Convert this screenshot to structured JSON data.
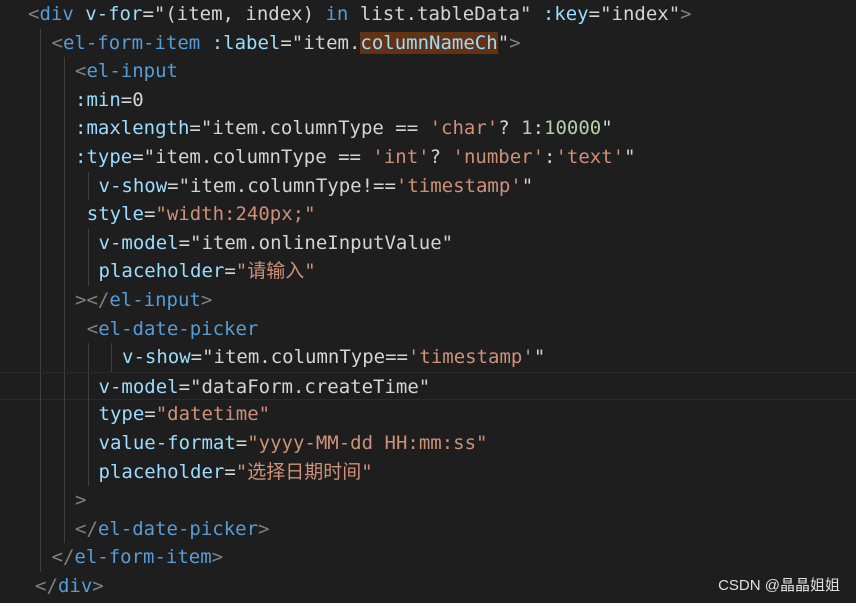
{
  "editor": {
    "lines": [
      {
        "indent": 0,
        "tokens": [
          {
            "t": "<",
            "c": "brk"
          },
          {
            "t": "div",
            "c": "tag"
          },
          {
            "t": " ",
            "c": "txt"
          },
          {
            "t": "v-for",
            "c": "attr"
          },
          {
            "t": "=\"",
            "c": "txt"
          },
          {
            "t": "(item, index) ",
            "c": "txt"
          },
          {
            "t": "in",
            "c": "kw"
          },
          {
            "t": " list.tableData",
            "c": "txt"
          },
          {
            "t": "\" ",
            "c": "txt"
          },
          {
            "t": ":key",
            "c": "attr"
          },
          {
            "t": "=\"index\"",
            "c": "txt"
          },
          {
            "t": ">",
            "c": "brk"
          }
        ]
      },
      {
        "indent": 1,
        "tokens": [
          {
            "t": "<",
            "c": "brk"
          },
          {
            "t": "el-form-item",
            "c": "tag"
          },
          {
            "t": " ",
            "c": "txt"
          },
          {
            "t": ":label",
            "c": "attr"
          },
          {
            "t": "=\"item.",
            "c": "txt"
          },
          {
            "t": "columnNameCh",
            "c": "attr",
            "hl": true
          },
          {
            "t": "\"",
            "c": "txt"
          },
          {
            "t": ">",
            "c": "brk"
          }
        ]
      },
      {
        "indent": 2,
        "tokens": [
          {
            "t": "<",
            "c": "brk"
          },
          {
            "t": "el-input",
            "c": "tag"
          }
        ]
      },
      {
        "indent": 2,
        "tokens": [
          {
            "t": ":min",
            "c": "attr"
          },
          {
            "t": "=0",
            "c": "txt"
          }
        ]
      },
      {
        "indent": 2,
        "tokens": [
          {
            "t": ":maxlength",
            "c": "attr"
          },
          {
            "t": "=\"item.columnType == ",
            "c": "txt"
          },
          {
            "t": "'char'",
            "c": "str"
          },
          {
            "t": "? ",
            "c": "txt"
          },
          {
            "t": "1",
            "c": "num"
          },
          {
            "t": ":",
            "c": "txt"
          },
          {
            "t": "10000",
            "c": "num"
          },
          {
            "t": "\"",
            "c": "txt"
          }
        ]
      },
      {
        "indent": 2,
        "tokens": [
          {
            "t": ":type",
            "c": "attr"
          },
          {
            "t": "=\"item.columnType == ",
            "c": "txt"
          },
          {
            "t": "'int'",
            "c": "str"
          },
          {
            "t": "? ",
            "c": "txt"
          },
          {
            "t": "'number'",
            "c": "str"
          },
          {
            "t": ":",
            "c": "txt"
          },
          {
            "t": "'text'",
            "c": "str"
          },
          {
            "t": "\"",
            "c": "txt"
          }
        ]
      },
      {
        "indent": 3,
        "tokens": [
          {
            "t": "v-show",
            "c": "attr"
          },
          {
            "t": "=\"item.columnType!==",
            "c": "txt"
          },
          {
            "t": "'timestamp'",
            "c": "str"
          },
          {
            "t": "\"",
            "c": "txt"
          }
        ]
      },
      {
        "indent": 2.5,
        "tokens": [
          {
            "t": "style",
            "c": "attr"
          },
          {
            "t": "=",
            "c": "txt"
          },
          {
            "t": "\"width:240px;\"",
            "c": "str"
          }
        ]
      },
      {
        "indent": 3,
        "tokens": [
          {
            "t": "v-model",
            "c": "attr"
          },
          {
            "t": "=\"item.onlineInputValue\"",
            "c": "txt"
          }
        ]
      },
      {
        "indent": 3,
        "tokens": [
          {
            "t": "placeholder",
            "c": "attr"
          },
          {
            "t": "=",
            "c": "txt"
          },
          {
            "t": "\"请输入\"",
            "c": "str"
          }
        ]
      },
      {
        "indent": 2,
        "tokens": [
          {
            "t": "></",
            "c": "brk"
          },
          {
            "t": "el-input",
            "c": "tag"
          },
          {
            "t": ">",
            "c": "brk"
          }
        ]
      },
      {
        "indent": 2.5,
        "tokens": [
          {
            "t": "<",
            "c": "brk"
          },
          {
            "t": "el-date-picker",
            "c": "tag"
          }
        ]
      },
      {
        "indent": 4,
        "tokens": [
          {
            "t": "v-show",
            "c": "attr"
          },
          {
            "t": "=\"item.columnType==",
            "c": "txt"
          },
          {
            "t": "'timestamp'",
            "c": "str"
          },
          {
            "t": "\"",
            "c": "txt"
          }
        ]
      },
      {
        "indent": 3,
        "current": true,
        "tokens": [
          {
            "t": "v-model",
            "c": "attr"
          },
          {
            "t": "=\"dataForm.createTime\"",
            "c": "txt"
          }
        ]
      },
      {
        "indent": 3,
        "tokens": [
          {
            "t": "type",
            "c": "attr"
          },
          {
            "t": "=",
            "c": "txt"
          },
          {
            "t": "\"datetime\"",
            "c": "str"
          }
        ]
      },
      {
        "indent": 3,
        "tokens": [
          {
            "t": "value-format",
            "c": "attr"
          },
          {
            "t": "=",
            "c": "txt"
          },
          {
            "t": "\"yyyy-MM-dd HH:mm:ss\"",
            "c": "str"
          }
        ]
      },
      {
        "indent": 3,
        "tokens": [
          {
            "t": "placeholder",
            "c": "attr"
          },
          {
            "t": "=",
            "c": "txt"
          },
          {
            "t": "\"选择日期时间\"",
            "c": "str"
          }
        ]
      },
      {
        "indent": 2,
        "tokens": [
          {
            "t": ">",
            "c": "brk"
          }
        ]
      },
      {
        "indent": 2,
        "tokens": [
          {
            "t": "</",
            "c": "brk"
          },
          {
            "t": "el-date-picker",
            "c": "tag"
          },
          {
            "t": ">",
            "c": "brk"
          }
        ]
      },
      {
        "indent": 1,
        "tokens": [
          {
            "t": "</",
            "c": "brk"
          },
          {
            "t": "el-form-item",
            "c": "tag"
          },
          {
            "t": ">",
            "c": "brk"
          }
        ]
      },
      {
        "indent": 0.3,
        "tokens": [
          {
            "t": "</",
            "c": "brk"
          },
          {
            "t": "div",
            "c": "tag"
          },
          {
            "t": ">",
            "c": "brk"
          }
        ]
      }
    ]
  },
  "watermark": {
    "text": "CSDN @晶晶姐姐"
  },
  "colors": {
    "background": "#1e1e1e",
    "tag": "#569cd6",
    "attribute": "#9cdcfe",
    "string": "#ce9178",
    "number": "#b5cea8",
    "bracket": "#808080",
    "text": "#d4d4d4",
    "find_highlight": "#613214"
  }
}
